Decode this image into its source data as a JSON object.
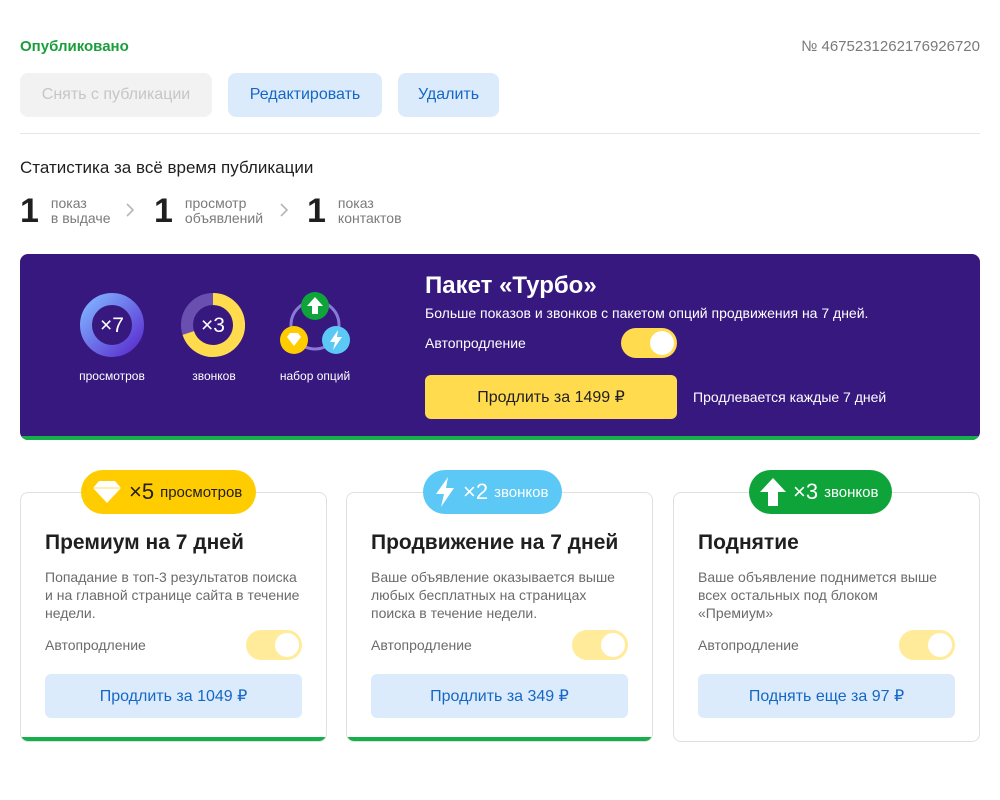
{
  "header": {
    "status": "Опубликовано",
    "ad_number": "№ 4675231262176926720",
    "actions": {
      "unpublish": "Снять с публикации",
      "edit": "Редактировать",
      "delete": "Удалить"
    }
  },
  "stats": {
    "title": "Статистика за всё время публикации",
    "items": [
      {
        "value": "1",
        "line1": "показ",
        "line2": "в выдаче"
      },
      {
        "value": "1",
        "line1": "просмотр",
        "line2": "объявлений"
      },
      {
        "value": "1",
        "line1": "показ",
        "line2": "контактов"
      }
    ]
  },
  "turbo": {
    "title": "Пакет «Турбо»",
    "subtitle": "Больше показов и звонков с пакетом опций продвижения на 7 дней.",
    "autorenew_label": "Автопродление",
    "autorenew_on": true,
    "buy_button": "Продлить за 1499 ₽",
    "renew_note": "Продлевается каждые 7 дней",
    "features": [
      {
        "value": "×7",
        "label": "просмотров"
      },
      {
        "value": "×3",
        "label": "звонков"
      },
      {
        "value": "",
        "label": "набор опций"
      }
    ]
  },
  "cards": [
    {
      "badge_multiplier": "×5",
      "badge_text": "просмотров",
      "title": "Премиум на 7 дней",
      "desc": [
        "Попадание в топ-3 результатов поиска",
        "и на главной странице сайта в течение",
        "недели."
      ],
      "autorenew_label": "Автопродление",
      "button": "Продлить за 1049 ₽"
    },
    {
      "badge_multiplier": "×2",
      "badge_text": "звонков",
      "title": "Продвижение на 7 дней",
      "desc": [
        "Ваше объявление оказывается выше",
        "любых бесплатных на страницах",
        "поиска в течение недели."
      ],
      "autorenew_label": "Автопродление",
      "button": "Продлить за 349 ₽"
    },
    {
      "badge_multiplier": "×3",
      "badge_text": "звонков",
      "title": "Поднятие",
      "desc": [
        "Ваше объявление поднимется выше",
        "всех остальных под блоком",
        "«Премиум»"
      ],
      "autorenew_label": "Автопродление",
      "button": "Поднять еще за 97 ₽"
    }
  ],
  "colors": {
    "published": "#1a9e3c",
    "turbo_bg": "#37187f",
    "accent_yellow": "#ffdb4d",
    "link_blue": "#1567c6",
    "green_bar": "#16b04a"
  }
}
